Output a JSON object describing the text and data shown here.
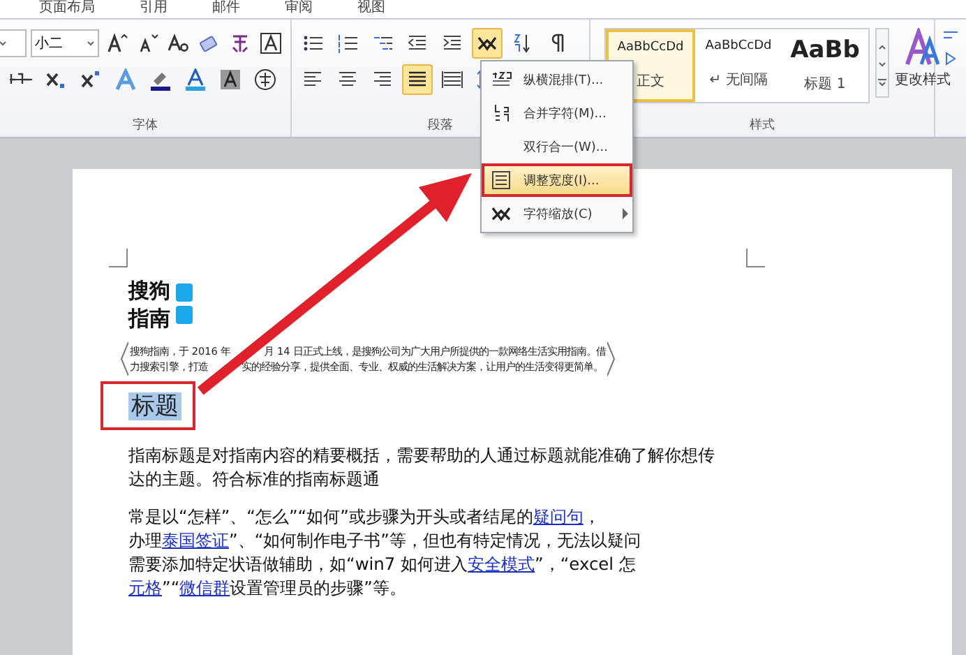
{
  "ribbon_tabs": [
    {
      "label": "页面布局",
      "selected": false
    },
    {
      "label": "引用",
      "selected": false
    },
    {
      "label": "邮件",
      "selected": false
    },
    {
      "label": "审阅",
      "selected": false
    },
    {
      "label": "视图",
      "selected": false
    }
  ],
  "font_group": {
    "font_size": "小二",
    "label": "字体"
  },
  "paragraph_group": {
    "label": "段落",
    "buttons": [
      {
        "kind": "bullets",
        "selected": false
      },
      {
        "kind": "numbering",
        "selected": false
      },
      {
        "kind": "multilevel",
        "selected": false
      },
      {
        "kind": "outdent",
        "selected": false
      },
      {
        "kind": "indent",
        "selected": false
      },
      {
        "kind": "asian-layout",
        "selected": true
      },
      {
        "kind": "sort",
        "selected": false
      },
      {
        "kind": "marks",
        "selected": false
      },
      {
        "kind": "align-left",
        "selected": false
      },
      {
        "kind": "align-center",
        "selected": false
      },
      {
        "kind": "align-right",
        "selected": false
      },
      {
        "kind": "justify",
        "selected": true
      },
      {
        "kind": "distribute",
        "selected": false
      },
      {
        "kind": "line-spacing",
        "selected": false
      }
    ]
  },
  "styles_group": {
    "label": "样式",
    "change_styles": "更改样式",
    "styles": [
      {
        "preview": "AaBbCcDd",
        "name": "正文",
        "kind": "normal",
        "selected": true
      },
      {
        "preview": "AaBbCcDd",
        "name": "↵ 无间隔",
        "kind": "normal",
        "selected": false
      },
      {
        "preview": "AaBb",
        "name": "标题 1",
        "kind": "heading",
        "selected": false
      }
    ]
  },
  "menu": {
    "items": [
      {
        "label": "纵横混排(T)...",
        "selected": false,
        "submenu": false
      },
      {
        "label": "合并字符(M)...",
        "selected": false,
        "submenu": false
      },
      {
        "label": "双行合一(W)...",
        "selected": false,
        "submenu": false
      },
      {
        "label": "调整宽度(I)...",
        "selected": true,
        "submenu": false
      },
      {
        "label": "字符缩放(C)",
        "selected": false,
        "submenu": true
      }
    ]
  },
  "document": {
    "logo_lines": [
      "搜狗",
      "指南"
    ],
    "intro_lines": [
      [
        "搜狗指南，于 2016 年",
        "月 14 日正式上线，是搜狗公司为广大用户所提供的一款网络生活实用指南。借"
      ],
      [
        "力搜索引擎，打造",
        "实的经验分享，提供全面、专业、权威的生活解决方案，让用户的生活变得更简单。"
      ]
    ],
    "heading": "标题",
    "paragraphs": [
      [
        [
          {
            "text": "指南标题是对指南内容的精要概括，需要帮助的人通过标题就能准确了解你想传",
            "link": false
          }
        ],
        [
          {
            "text": "达的主题。符合标准的指南标题通",
            "link": false
          }
        ]
      ],
      [
        [
          {
            "text": "常是以“怎样”、“怎么”“如何”或步骤为开头或者结尾的",
            "link": false
          },
          {
            "text": "疑问句",
            "link": true
          },
          {
            "text": "，",
            "link": false
          }
        ],
        [
          {
            "text": "办理",
            "link": false
          },
          {
            "text": "泰国签证",
            "link": true
          },
          {
            "text": "”、“如何制作电子书”等，但也有特定情况，无法以疑问",
            "link": false
          }
        ],
        [
          {
            "text": "需要添加特定状语做辅助，如“win7 如何进入",
            "link": false
          },
          {
            "text": "安全模式",
            "link": true
          },
          {
            "text": "”，“excel 怎",
            "link": false
          }
        ],
        [
          {
            "text": "元格",
            "link": true
          },
          {
            "text": "”“",
            "link": false
          },
          {
            "text": "微信群",
            "link": true
          },
          {
            "text": "设置管理员的步骤”等。",
            "link": false
          }
        ]
      ]
    ]
  }
}
